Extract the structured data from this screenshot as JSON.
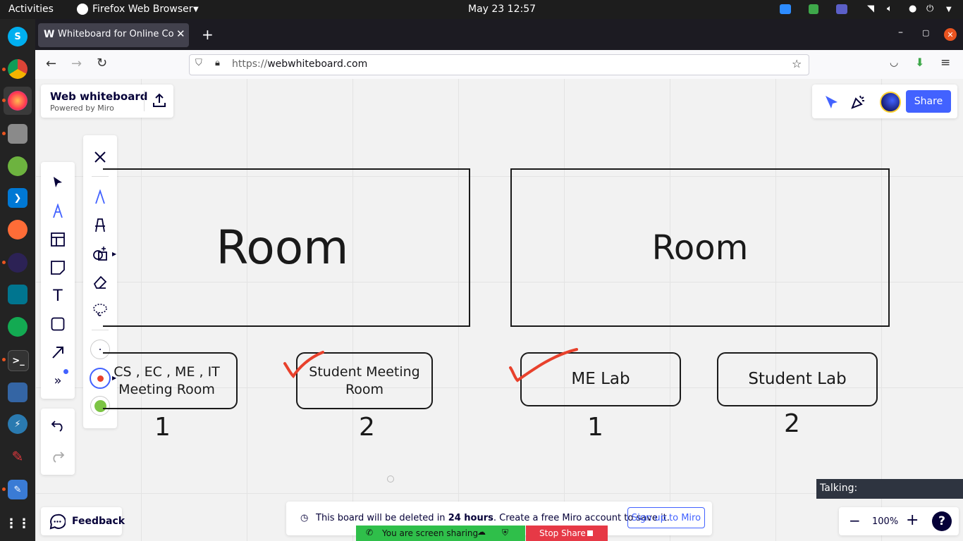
{
  "topbar": {
    "activities": "Activities",
    "app_name": "Firefox Web Browser",
    "clock": "May 23  12:57"
  },
  "browser": {
    "tab_title": "Whiteboard for Online Co",
    "url_prefix": "https://",
    "url_domain": "webwhiteboard.com"
  },
  "board": {
    "brand_title": "Web whiteboard",
    "brand_subtitle": "Powered by Miro",
    "share_label": "Share",
    "rooms": [
      {
        "label": "Room"
      },
      {
        "label": "Room"
      }
    ],
    "stickies": [
      {
        "line1": "CS , EC , ME , IT",
        "line2": "Meeting Room",
        "number": "1"
      },
      {
        "line1": "Student Meeting",
        "line2": "Room",
        "number": "2"
      },
      {
        "line1": "ME Lab",
        "line2": "",
        "number": "1"
      },
      {
        "line1": "Student Lab",
        "line2": "",
        "number": "2"
      }
    ],
    "accent_color": "#4262ff",
    "pen_color": "#e8412c",
    "green_color": "#7cc444"
  },
  "notice": {
    "text_before": "This board will be deleted in ",
    "text_bold": "24 hours",
    "text_after": ". Create a free Miro account to save it.",
    "signup_label": "Sign up to Miro"
  },
  "screenshare": {
    "status": "You are screen sharing",
    "stop_label": "Stop Share"
  },
  "talking": {
    "label": "Talking:"
  },
  "feedback": {
    "label": "Feedback"
  },
  "zoom": {
    "level": "100%"
  }
}
